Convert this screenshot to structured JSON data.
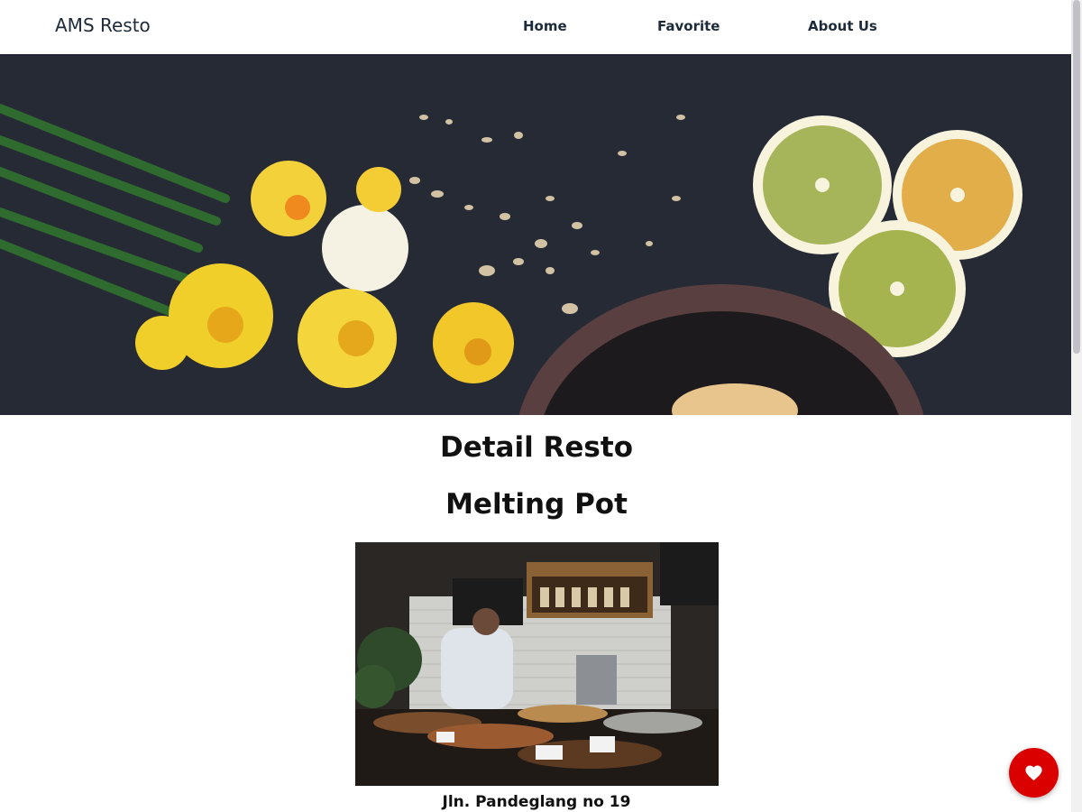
{
  "header": {
    "brand": "AMS Resto",
    "nav": [
      {
        "label": "Home"
      },
      {
        "label": "Favorite"
      },
      {
        "label": "About Us"
      }
    ]
  },
  "hero": {
    "icon": "hero-image"
  },
  "detail": {
    "heading": "Detail Resto",
    "name": "Melting Pot",
    "image_icon": "restaurant-image",
    "address": "Jln. Pandeglang no 19"
  },
  "fab": {
    "icon": "heart-icon",
    "color": "#db0000"
  }
}
